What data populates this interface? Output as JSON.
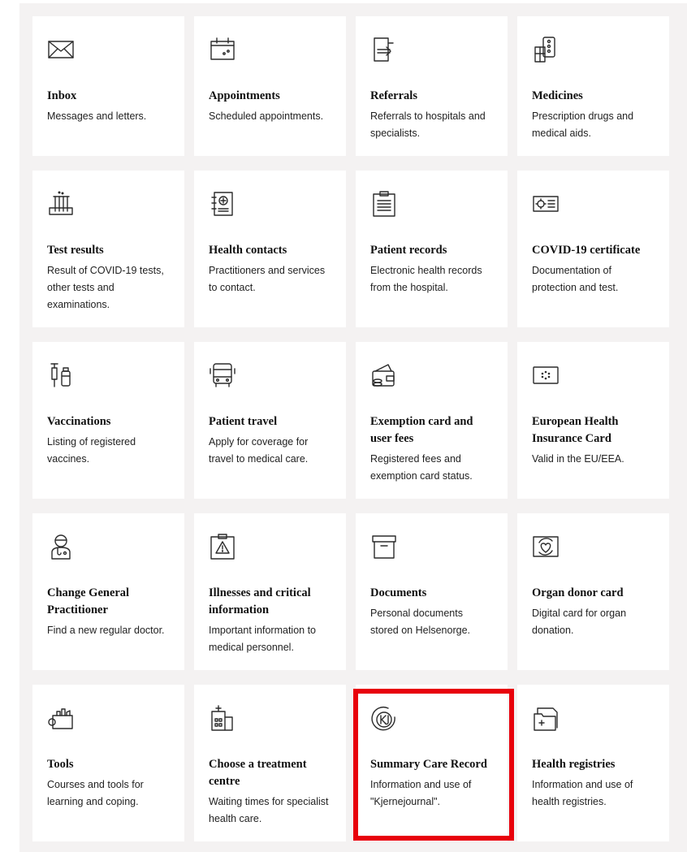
{
  "accent": {
    "highlight_border": "#e8000b",
    "panel_bg": "#f4f2f2"
  },
  "cards": [
    {
      "icon": "envelope-icon",
      "title": "Inbox",
      "desc": "Messages and letters."
    },
    {
      "icon": "calendar-icon",
      "title": "Appointments",
      "desc": "Scheduled appointments."
    },
    {
      "icon": "referral-document-icon",
      "title": "Referrals",
      "desc": "Referrals to hospitals and specialists."
    },
    {
      "icon": "pill-package-icon",
      "title": "Medicines",
      "desc": "Prescription drugs and medical aids."
    },
    {
      "icon": "test-tubes-icon",
      "title": "Test results",
      "desc": "Result of COVID-19 tests, other tests and examinations."
    },
    {
      "icon": "address-book-icon",
      "title": "Health contacts",
      "desc": "Practitioners and services to contact."
    },
    {
      "icon": "clipboard-icon",
      "title": "Patient records",
      "desc": "Electronic health records from the hospital."
    },
    {
      "icon": "certificate-icon",
      "title": "COVID-19 certificate",
      "desc": "Documentation of protection and test."
    },
    {
      "icon": "syringe-vial-icon",
      "title": "Vaccinations",
      "desc": "Listing of registered vaccines."
    },
    {
      "icon": "bus-icon",
      "title": "Patient travel",
      "desc": "Apply for coverage for travel to medical care."
    },
    {
      "icon": "wallet-icon",
      "title": "Exemption card and user fees",
      "desc": "Registered fees and exemption card status."
    },
    {
      "icon": "eu-card-icon",
      "title": "European Health Insurance Card",
      "desc": "Valid in the EU/EEA."
    },
    {
      "icon": "doctor-icon",
      "title": "Change General Practitioner",
      "desc": "Find a new regular doctor."
    },
    {
      "icon": "warning-clipboard-icon",
      "title": "Illnesses and critical information",
      "desc": "Important information to medical personnel."
    },
    {
      "icon": "archive-box-icon",
      "title": "Documents",
      "desc": "Personal documents stored on Helsenorge."
    },
    {
      "icon": "donor-heart-card-icon",
      "title": "Organ donor card",
      "desc": "Digital card for organ donation."
    },
    {
      "icon": "toolbox-icon",
      "title": "Tools",
      "desc": "Courses and tools for learning and coping."
    },
    {
      "icon": "hospital-building-icon",
      "title": "Choose a treatment centre",
      "desc": "Waiting times for specialist health care."
    },
    {
      "icon": "kj-logo-icon",
      "title": "Summary Care Record",
      "desc": "Information and use of \"Kjernejournal\"."
    },
    {
      "icon": "folders-plus-icon",
      "title": "Health registries",
      "desc": "Information and use of health registries."
    }
  ]
}
